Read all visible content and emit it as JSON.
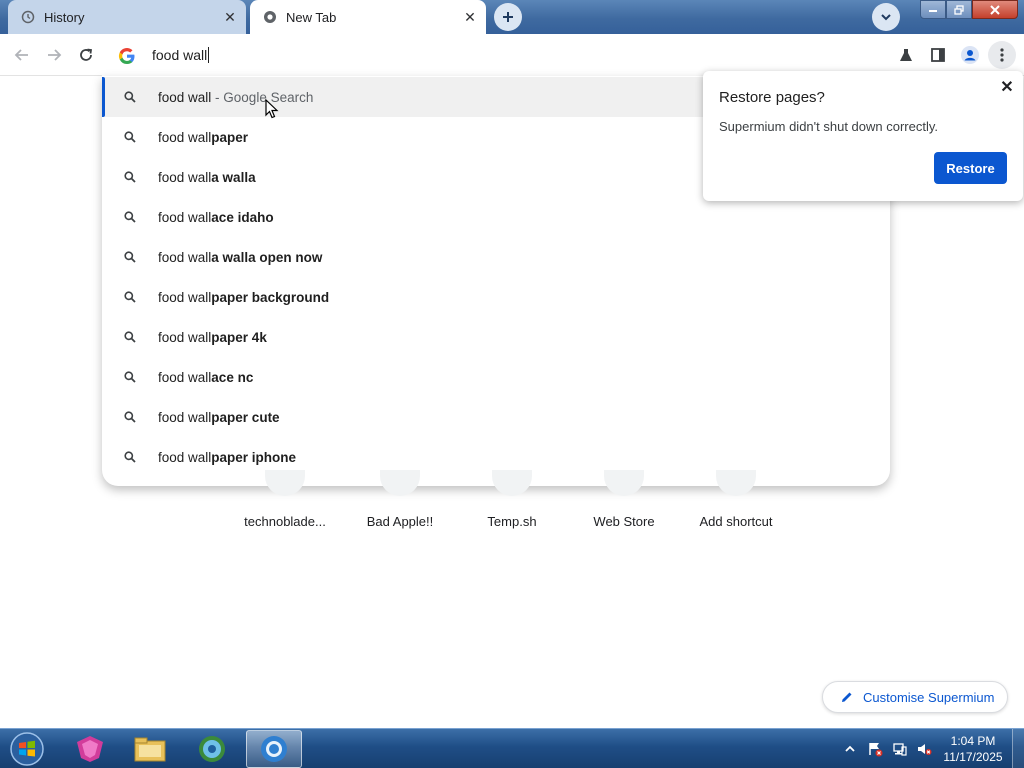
{
  "tabs": [
    {
      "title": "History",
      "icon": "history-icon"
    },
    {
      "title": "New Tab",
      "icon": "chromium-icon"
    }
  ],
  "omnibox": {
    "value": "food wall"
  },
  "suggestions": [
    {
      "typed": "food wall",
      "completion": "",
      "suffix": " - Google Search"
    },
    {
      "typed": "food wall",
      "completion": "paper",
      "suffix": ""
    },
    {
      "typed": "food wall",
      "completion": "a walla",
      "suffix": ""
    },
    {
      "typed": "food wall",
      "completion": "ace idaho",
      "suffix": ""
    },
    {
      "typed": "food wall",
      "completion": "a walla open now",
      "suffix": ""
    },
    {
      "typed": "food wall",
      "completion": "paper background",
      "suffix": ""
    },
    {
      "typed": "food wall",
      "completion": "paper 4k",
      "suffix": ""
    },
    {
      "typed": "food wall",
      "completion": "ace nc",
      "suffix": ""
    },
    {
      "typed": "food wall",
      "completion": "paper cute",
      "suffix": ""
    },
    {
      "typed": "food wall",
      "completion": "paper iphone",
      "suffix": ""
    }
  ],
  "restore_popup": {
    "title": "Restore pages?",
    "message": "Supermium didn't shut down correctly.",
    "button": "Restore"
  },
  "shortcuts": [
    {
      "label": "technoblade..."
    },
    {
      "label": "Bad Apple!!"
    },
    {
      "label": "Temp.sh"
    },
    {
      "label": "Web Store"
    },
    {
      "label": "Add shortcut"
    }
  ],
  "customise": {
    "label": "Customise Supermium"
  },
  "taskbar": {
    "time": "1:04 PM",
    "date": "11/17/2025"
  },
  "colors": {
    "accent": "#0b57d0",
    "taskbar": "#1f4e86"
  }
}
